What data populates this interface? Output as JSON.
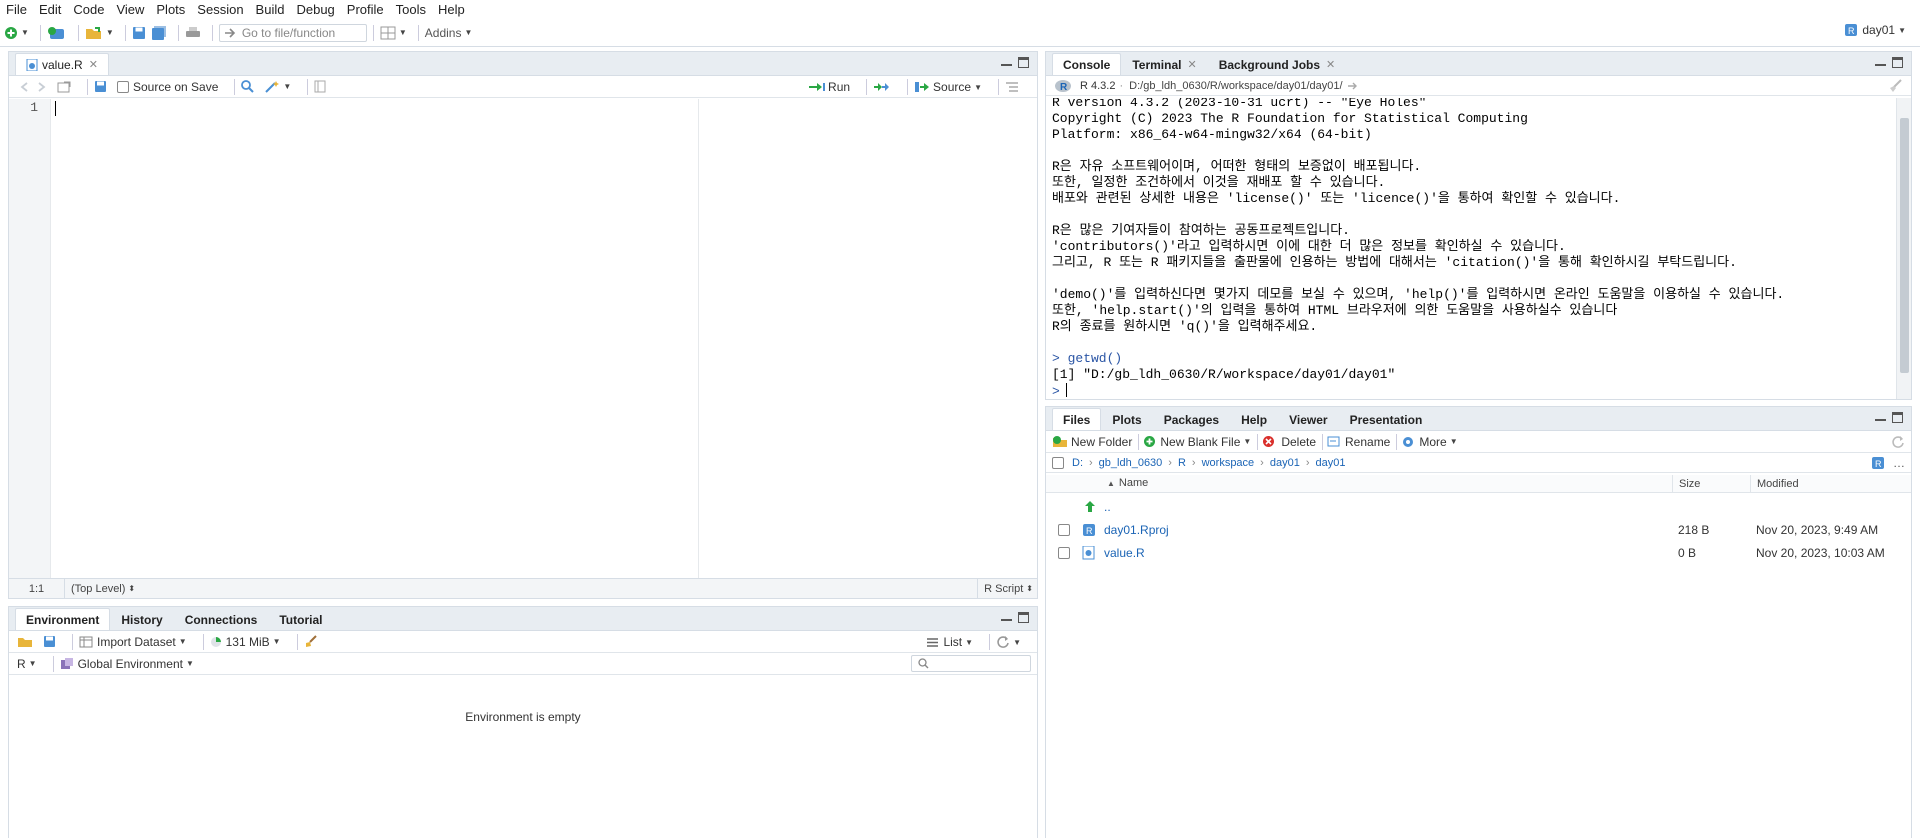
{
  "menu": [
    "File",
    "Edit",
    "Code",
    "View",
    "Plots",
    "Session",
    "Build",
    "Debug",
    "Profile",
    "Tools",
    "Help"
  ],
  "toolbar": {
    "goto_placeholder": "Go to file/function",
    "addins_label": "Addins",
    "project_name": "day01"
  },
  "source_pane": {
    "tab_label": "value.R",
    "source_on_save_label": "Source on Save",
    "run_label": "Run",
    "source_label": "Source",
    "line_number": "1",
    "status_position": "1:1",
    "status_scope": "(Top Level)",
    "status_filetype": "R Script"
  },
  "console_pane": {
    "tabs": [
      "Console",
      "Terminal",
      "Background Jobs"
    ],
    "r_version": "R 4.3.2",
    "working_dir": "D:/gb_ldh_0630/R/workspace/day01/day01/",
    "lines": [
      "R version 4.3.2 (2023-10-31 ucrt) -- \"Eye Holes\"",
      "Copyright (C) 2023 The R Foundation for Statistical Computing",
      "Platform: x86_64-w64-mingw32/x64 (64-bit)",
      "",
      "R은 자유 소프트웨어이며, 어떠한 형태의 보증없이 배포됩니다.",
      "또한, 일정한 조건하에서 이것을 재배포 할 수 있습니다.",
      "배포와 관련된 상세한 내용은 'license()' 또는 'licence()'을 통하여 확인할 수 있습니다.",
      "",
      "R은 많은 기여자들이 참여하는 공동프로젝트입니다.",
      "'contributors()'라고 입력하시면 이에 대한 더 많은 정보를 확인하실 수 있습니다.",
      "그리고, R 또는 R 패키지들을 출판물에 인용하는 방법에 대해서는 'citation()'을 통해 확인하시길 부탁드립니다.",
      "",
      "'demo()'를 입력하신다면 몇가지 데모를 보실 수 있으며, 'help()'를 입력하시면 온라인 도움말을 이용하실 수 있습니다.",
      "또한, 'help.start()'의 입력을 통하여 HTML 브라우저에 의한 도움말을 사용하실수 있습니다",
      "R의 종료를 원하시면 'q()'을 입력해주세요.",
      ""
    ],
    "command": "> getwd()",
    "result": "[1] \"D:/gb_ldh_0630/R/workspace/day01/day01\"",
    "prompt": ">"
  },
  "env_pane": {
    "tabs": [
      "Environment",
      "History",
      "Connections",
      "Tutorial"
    ],
    "import_label": "Import Dataset",
    "memory_label": "131 MiB",
    "list_label": "List",
    "lang_label": "R",
    "env_label": "Global Environment",
    "empty_message": "Environment is empty"
  },
  "files_pane": {
    "tabs": [
      "Files",
      "Plots",
      "Packages",
      "Help",
      "Viewer",
      "Presentation"
    ],
    "new_folder_label": "New Folder",
    "new_file_label": "New Blank File",
    "delete_label": "Delete",
    "rename_label": "Rename",
    "more_label": "More",
    "breadcrumb": [
      "D:",
      "gb_ldh_0630",
      "R",
      "workspace",
      "day01",
      "day01"
    ],
    "col_name": "Name",
    "col_size": "Size",
    "col_modified": "Modified",
    "parent_label": "..",
    "rows": [
      {
        "name": "day01.Rproj",
        "size": "218 B",
        "modified": "Nov 20, 2023, 9:49 AM"
      },
      {
        "name": "value.R",
        "size": "0 B",
        "modified": "Nov 20, 2023, 10:03 AM"
      }
    ]
  },
  "colors": {
    "accent": "#1b64b5",
    "green": "#2aa744",
    "tabbar": "#e8edf2"
  }
}
